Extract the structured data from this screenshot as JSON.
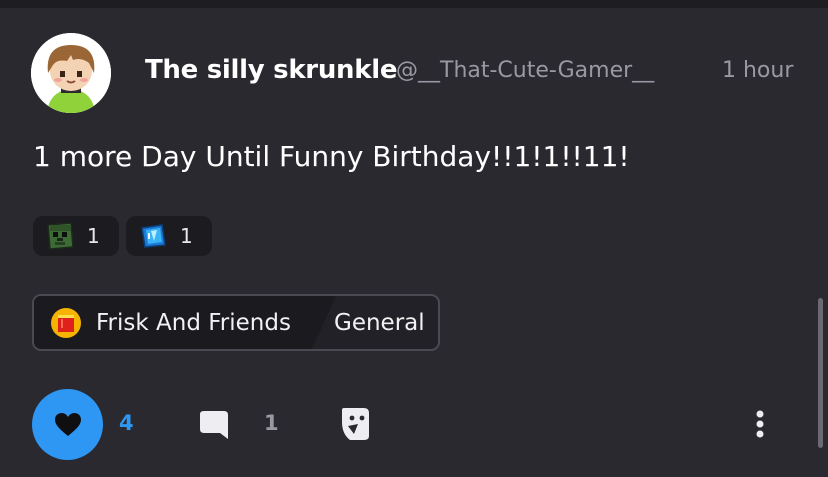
{
  "post": {
    "author": {
      "display_name": "The silly skrunkle",
      "handle": "@__That-Cute-Gamer__",
      "avatar_icon": "avatar-character-icon"
    },
    "timestamp": "1 hour",
    "text": "1 more Day Until Funny Birthday!!1!1!!11!",
    "reactions": [
      {
        "icon": "zombie-face-emoji-icon",
        "count": "1"
      },
      {
        "icon": "blue-crystal-emoji-icon",
        "count": "1"
      }
    ],
    "community": {
      "icon": "community-icon",
      "name": "Frisk And Friends",
      "channel": "General"
    },
    "actions": {
      "like_count": "4",
      "comment_count": "1",
      "like_icon": "heart-icon",
      "comment_icon": "comment-bubble-icon",
      "share_icon": "share-icon",
      "more_icon": "more-options-icon"
    }
  },
  "colors": {
    "background": "#2a2930",
    "accent_blue": "#2e96f3",
    "muted_text": "#9a99a3"
  }
}
